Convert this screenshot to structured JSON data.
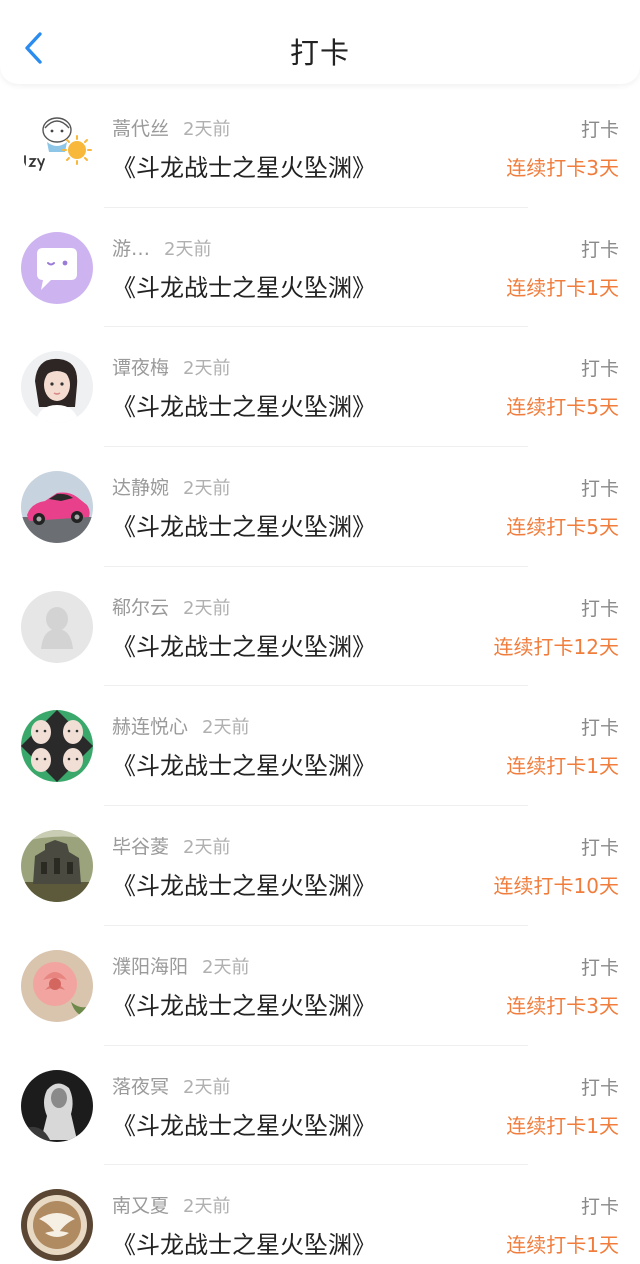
{
  "header": {
    "title": "打卡",
    "back_icon": "chevron-left-icon",
    "accent": "#2b8cf0"
  },
  "colors": {
    "streak": "#f07d3c",
    "name": "#9a9a9a",
    "title_text": "#222222"
  },
  "checkins": [
    {
      "name": "蒿代丝",
      "time": "2天前",
      "book": "《斗龙战士之星火坠渊》",
      "action": "打卡",
      "streak": "连续打卡3天",
      "avatar": "avatar-lzy-sun-icon"
    },
    {
      "name": "游…",
      "time": "2天前",
      "book": "《斗龙战士之星火坠渊》",
      "action": "打卡",
      "streak": "连续打卡1天",
      "avatar": "avatar-purple-chat-icon"
    },
    {
      "name": "谭夜梅",
      "time": "2天前",
      "book": "《斗龙战士之星火坠渊》",
      "action": "打卡",
      "streak": "连续打卡5天",
      "avatar": "avatar-girl-photo"
    },
    {
      "name": "达静婉",
      "time": "2天前",
      "book": "《斗龙战士之星火坠渊》",
      "action": "打卡",
      "streak": "连续打卡5天",
      "avatar": "avatar-pink-car-photo"
    },
    {
      "name": "郗尔云",
      "time": "2天前",
      "book": "《斗龙战士之星火坠渊》",
      "action": "打卡",
      "streak": "连续打卡12天",
      "avatar": "avatar-default-penguin-icon"
    },
    {
      "name": "赫连悦心",
      "time": "2天前",
      "book": "《斗龙战士之星火坠渊》",
      "action": "打卡",
      "streak": "连续打卡1天",
      "avatar": "avatar-green-faces-photo"
    },
    {
      "name": "毕谷菱",
      "time": "2天前",
      "book": "《斗龙战士之星火坠渊》",
      "action": "打卡",
      "streak": "连续打卡10天",
      "avatar": "avatar-ruins-photo"
    },
    {
      "name": "濮阳海阳",
      "time": "2天前",
      "book": "《斗龙战士之星火坠渊》",
      "action": "打卡",
      "streak": "连续打卡3天",
      "avatar": "avatar-rose-photo"
    },
    {
      "name": "落夜冥",
      "time": "2天前",
      "book": "《斗龙战士之星火坠渊》",
      "action": "打卡",
      "streak": "连续打卡1天",
      "avatar": "avatar-dark-figure-photo"
    },
    {
      "name": "南又夏",
      "time": "2天前",
      "book": "《斗龙战士之星火坠渊》",
      "action": "打卡",
      "streak": "连续打卡1天",
      "avatar": "avatar-latte-art-photo"
    }
  ]
}
